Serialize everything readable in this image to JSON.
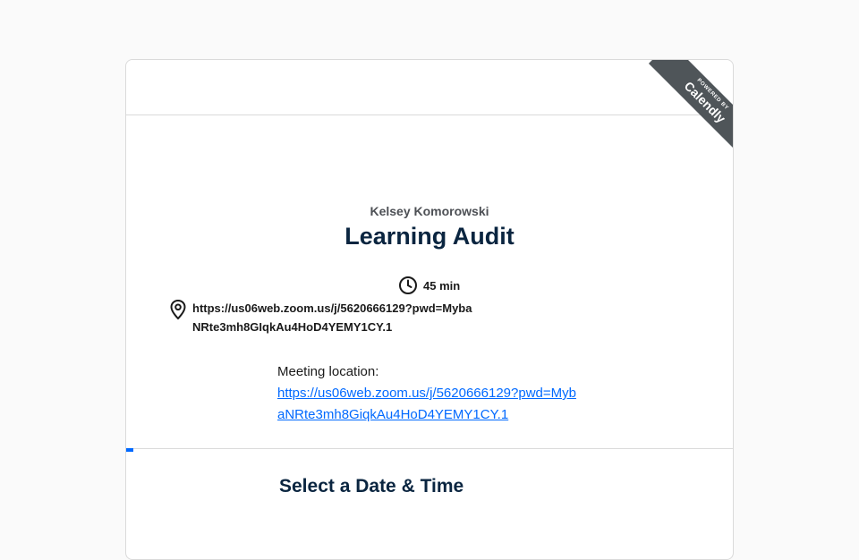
{
  "badge": {
    "powered_by": "POWERED BY",
    "brand": "Calendly"
  },
  "event": {
    "host_name": "Kelsey Komorowski",
    "title": "Learning Audit",
    "duration": "45 min",
    "location": "https://us06web.zoom.us/j/5620666129?pwd=MybaNRte3mh8GIqkAu4HoD4YEMY1CY.1"
  },
  "meeting": {
    "label": "Meeting location:",
    "link": "https://us06web.zoom.us/j/5620666129?pwd=MybaNRte3mh8GiqkAu4HoD4YEMY1CY.1"
  },
  "booking": {
    "section_title": "Select a Date & Time",
    "progress": 0.01
  },
  "colors": {
    "accent": "#0069ff",
    "title": "#0a2540",
    "ribbon": "#4f5559"
  },
  "icons": {
    "duration": "clock-icon",
    "location": "location-pin-icon"
  }
}
